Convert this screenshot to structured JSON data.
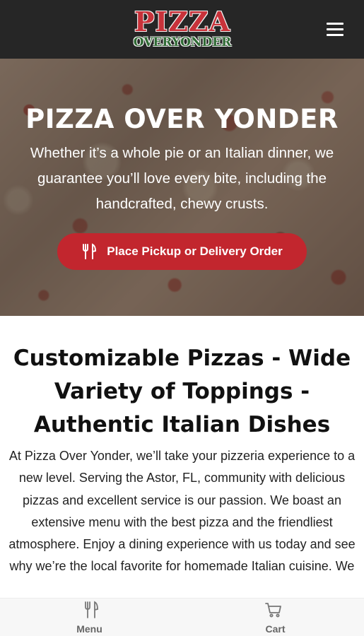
{
  "header": {
    "logo_top": "PIZZA",
    "logo_bottom": "OVERYONDER",
    "menu_icon": "hamburger-menu-icon"
  },
  "hero": {
    "title": "PIZZA OVER YONDER",
    "text": "Whether it’s a whole pie or an Italian dinner, we guarantee you’ll love every bite, including the handcrafted, chewy crusts.",
    "cta_icon": "fork-knife-icon",
    "cta_label": "Place Pickup or Delivery Order"
  },
  "content": {
    "title": "Customizable Pizzas - Wide Variety of Toppings - Authentic Italian Dishes",
    "text": "At Pizza Over Yonder, we’ll take your pizzeria experience to a new level. Serving the Astor, FL, community with delicious pizzas and excellent service is our passion. We boast an extensive menu with the best pizza and the friendliest atmosphere. Enjoy a dining experience with us today and see why we’re the local favorite for homemade Italian cuisine. We"
  },
  "bottom_nav": {
    "menu_label": "Menu",
    "menu_icon": "fork-knife-icon",
    "cart_label": "Cart",
    "cart_icon": "cart-icon"
  },
  "colors": {
    "header_bg": "#262626",
    "accent_red": "#c2262e",
    "logo_green": "#2f6a34"
  }
}
